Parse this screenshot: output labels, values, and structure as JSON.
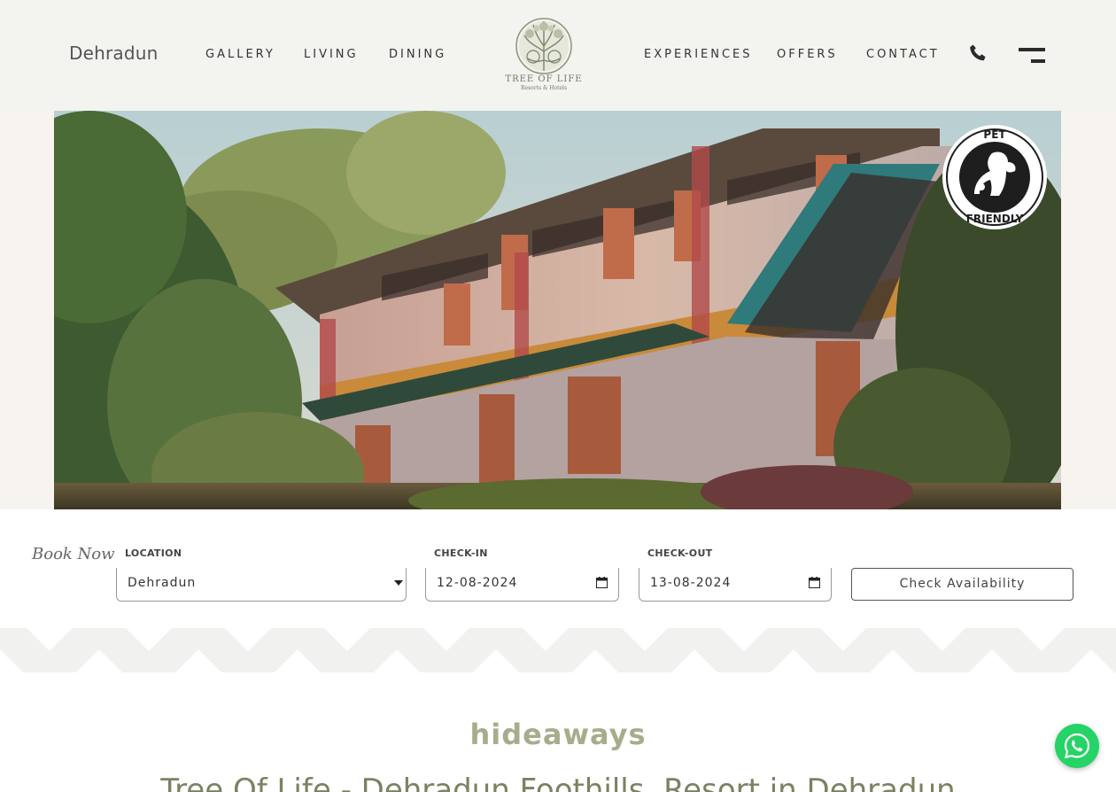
{
  "header": {
    "city": "Dehradun",
    "nav_left": [
      "GALLERY",
      "LIVING",
      "DINING"
    ],
    "nav_right": [
      "EXPERIENCES",
      "OFFERS",
      "CONTACT"
    ],
    "logo_name": "TREE OF LIFE",
    "logo_sub": "Resorts & Hotels",
    "icons": [
      "phone-icon",
      "menu-icon"
    ]
  },
  "hero": {
    "badge_top": "PET",
    "badge_bottom": "FRIENDLY"
  },
  "booking": {
    "title": "Book Now",
    "location_label": "LOCATION",
    "location_value": "Dehradun",
    "checkin_label": "CHECK-IN",
    "checkin_value": "12-08-2024",
    "checkout_label": "CHECK-OUT",
    "checkout_value": "13-08-2024",
    "button_label": "Check Availability"
  },
  "content": {
    "hideaways": "hideaways",
    "headline": "Tree Of Life - Dehradun Foothills, Resort in Dehradun"
  },
  "colors": {
    "header_bg": "#f3f3ef",
    "accent_olive": "#7a8262",
    "hideaways_text": "#a7ad8c",
    "whatsapp": "#25d366"
  }
}
